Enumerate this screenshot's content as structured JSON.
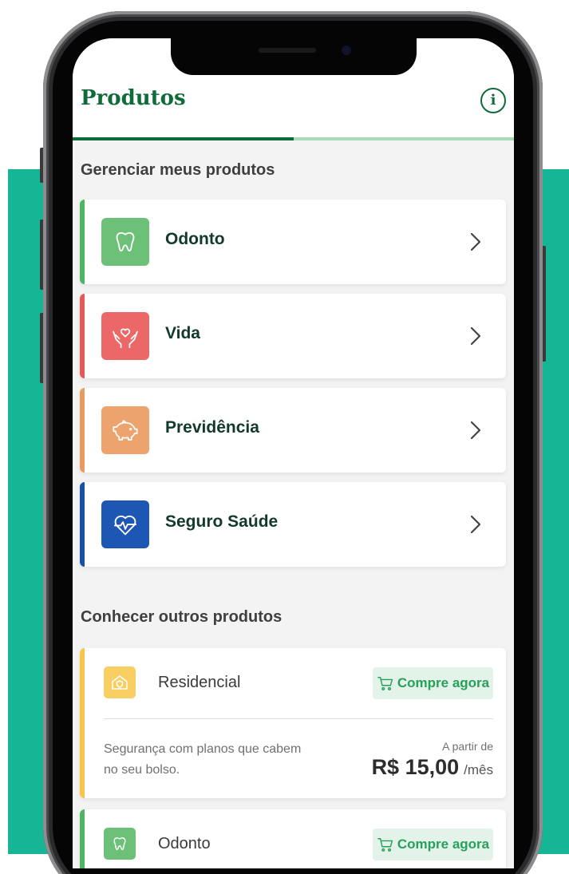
{
  "header": {
    "title": "Produtos",
    "info_icon": "info-icon"
  },
  "sections": {
    "manage_title": "Gerenciar meus produtos",
    "other_title": "Conhecer outros produtos"
  },
  "my_products": [
    {
      "label": "Odonto",
      "icon": "tooth-icon",
      "color": "#4fb564",
      "icon_bg": "#6cc077"
    },
    {
      "label": "Vida",
      "icon": "hands-heart-icon",
      "color": "#e4595a",
      "icon_bg": "#ec6767"
    },
    {
      "label": "Previdência",
      "icon": "piggy-bank-icon",
      "color": "#e79b5e",
      "icon_bg": "#eca36d"
    },
    {
      "label": "Seguro Saúde",
      "icon": "heart-pulse-icon",
      "color": "#1b4fa1",
      "icon_bg": "#1e56b3"
    }
  ],
  "other_products": [
    {
      "name": "Residencial",
      "icon": "home-shield-icon",
      "color": "#f6c64a",
      "icon_bg": "#f9cf63",
      "buy_label": "Compre agora",
      "description": "Segurança com planos que cabem no seu bolso.",
      "from_label": "A partir de",
      "price": "R$ 15,00",
      "period": "/mês"
    },
    {
      "name": "Odonto",
      "icon": "tooth-icon",
      "color": "#4fb564",
      "icon_bg": "#6cc077",
      "buy_label": "Compre agora"
    }
  ],
  "colors": {
    "brand_green": "#0f6b3a",
    "teal_background": "#15b595",
    "buy_button_text": "#27a05a",
    "buy_button_bg": "#e3f3ea"
  }
}
